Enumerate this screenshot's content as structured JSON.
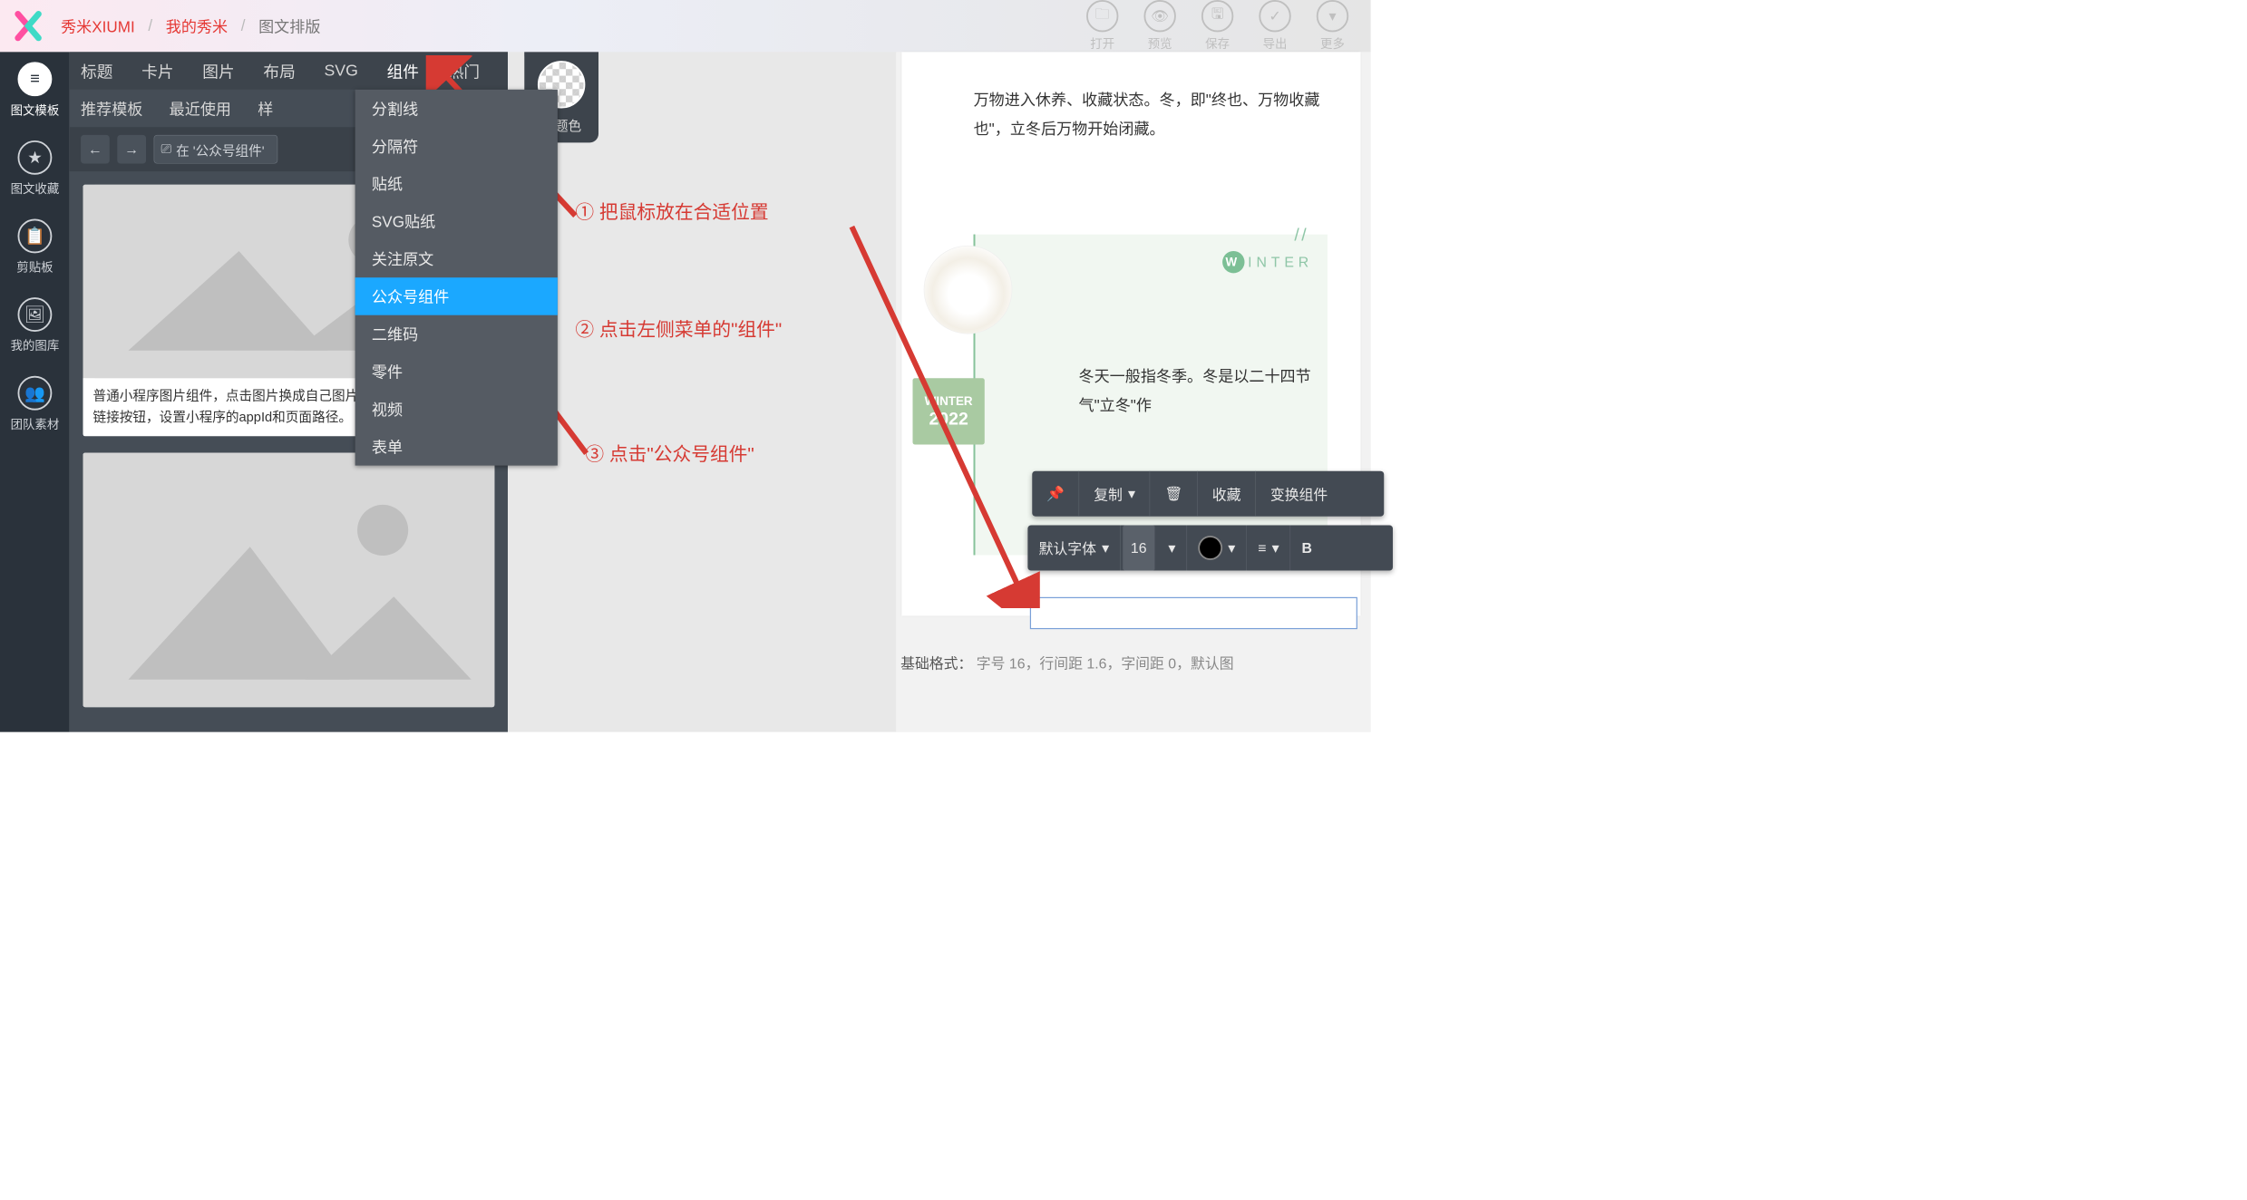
{
  "breadcrumb": {
    "brand": "秀米XIUMI",
    "mine": "我的秀米",
    "current": "图文排版"
  },
  "topActions": {
    "open": "打开",
    "preview": "预览",
    "save": "保存",
    "export": "导出",
    "more": "更多"
  },
  "rail": {
    "templates": "图文模板",
    "fav": "图文收藏",
    "clip": "剪贴板",
    "gallery": "我的图库",
    "team": "团队素材"
  },
  "tabs": {
    "title": "标题",
    "card": "卡片",
    "image": "图片",
    "layout": "布局",
    "svg": "SVG",
    "component": "组件",
    "hot": "热门"
  },
  "subtabs": {
    "recommend": "推荐模板",
    "recent": "最近使用",
    "sample": "样"
  },
  "search": {
    "placeholder": "在 '公众号组件'"
  },
  "dropdown": {
    "items": [
      "分割线",
      "分隔符",
      "贴纸",
      "SVG贴纸",
      "关注原文",
      "公众号组件",
      "二维码",
      "零件",
      "视频",
      "表单"
    ],
    "active_index": 5
  },
  "theme": {
    "label": "主题色"
  },
  "cardDesc": "普通小程序图片组件，点击图片换成自己图片，再点击工具条上的链接按钮，设置小程序的appId和页面路径。",
  "doc": {
    "para": "万物进入休养、收藏状态。冬，即\"终也、万物收藏也\"，立冬后万物开始闭藏。",
    "winter_label": "INTER",
    "winter_badge": "W",
    "slashes": "//",
    "card_line1": "WINTER",
    "card_line2": "2022",
    "body": "冬天一般指冬季。冬是以二十四节气\"立冬\"作"
  },
  "toolbar1": {
    "pin": "📌",
    "copy": "复制",
    "trash": "🗑",
    "fav": "收藏",
    "transform": "变换组件"
  },
  "toolbar2": {
    "font": "默认字体",
    "size": "16",
    "bold": "B"
  },
  "footer": {
    "label": "基础格式：",
    "text": "字号 16，行间距 1.6，字间距 0，默认图"
  },
  "annotations": {
    "a1": "① 把鼠标放在合适位置",
    "a2": "② 点击左侧菜单的\"组件\"",
    "a3": "③ 点击\"公众号组件\""
  }
}
